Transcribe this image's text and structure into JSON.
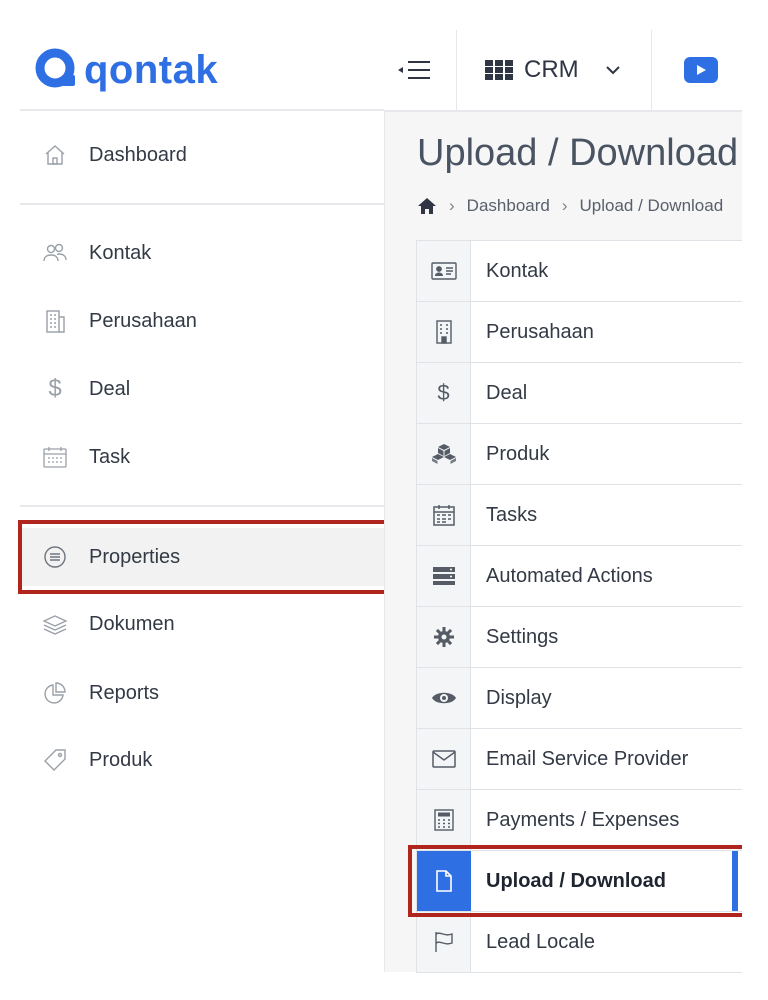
{
  "brand": {
    "name": "qontak"
  },
  "sidebar": {
    "items": [
      {
        "label": "Dashboard",
        "icon": "home-icon"
      },
      {
        "label": "Kontak",
        "icon": "contacts-icon"
      },
      {
        "label": "Perusahaan",
        "icon": "building-icon"
      },
      {
        "label": "Deal",
        "icon": "dollar-icon"
      },
      {
        "label": "Task",
        "icon": "calendar-icon"
      },
      {
        "label": "Properties",
        "icon": "list-circle-icon",
        "active": true
      },
      {
        "label": "Dokumen",
        "icon": "layers-icon"
      },
      {
        "label": "Reports",
        "icon": "pie-chart-icon"
      },
      {
        "label": "Produk",
        "icon": "tag-icon"
      }
    ]
  },
  "topbar": {
    "menu_icon": "menu-collapse-icon",
    "crm_label": "CRM",
    "crm_icon": "grid-icon",
    "video_icon": "play-icon"
  },
  "page": {
    "title": "Upload / Download",
    "breadcrumb": [
      "Dashboard",
      "Upload / Download"
    ]
  },
  "settings_menu": [
    {
      "label": "Kontak",
      "icon": "id-card-icon"
    },
    {
      "label": "Perusahaan",
      "icon": "building-icon"
    },
    {
      "label": "Deal",
      "icon": "dollar-icon"
    },
    {
      "label": "Produk",
      "icon": "cubes-icon"
    },
    {
      "label": "Tasks",
      "icon": "calendar-icon"
    },
    {
      "label": "Automated Actions",
      "icon": "server-icon"
    },
    {
      "label": "Settings",
      "icon": "gear-icon"
    },
    {
      "label": "Display",
      "icon": "eye-icon"
    },
    {
      "label": "Email Service Provider",
      "icon": "envelope-icon"
    },
    {
      "label": "Payments / Expenses",
      "icon": "calculator-icon"
    },
    {
      "label": "Upload / Download",
      "icon": "file-icon",
      "active": true
    },
    {
      "label": "Lead Locale",
      "icon": "flag-icon"
    }
  ],
  "colors": {
    "accent": "#2f6fe4",
    "highlight": "#b0251d"
  }
}
